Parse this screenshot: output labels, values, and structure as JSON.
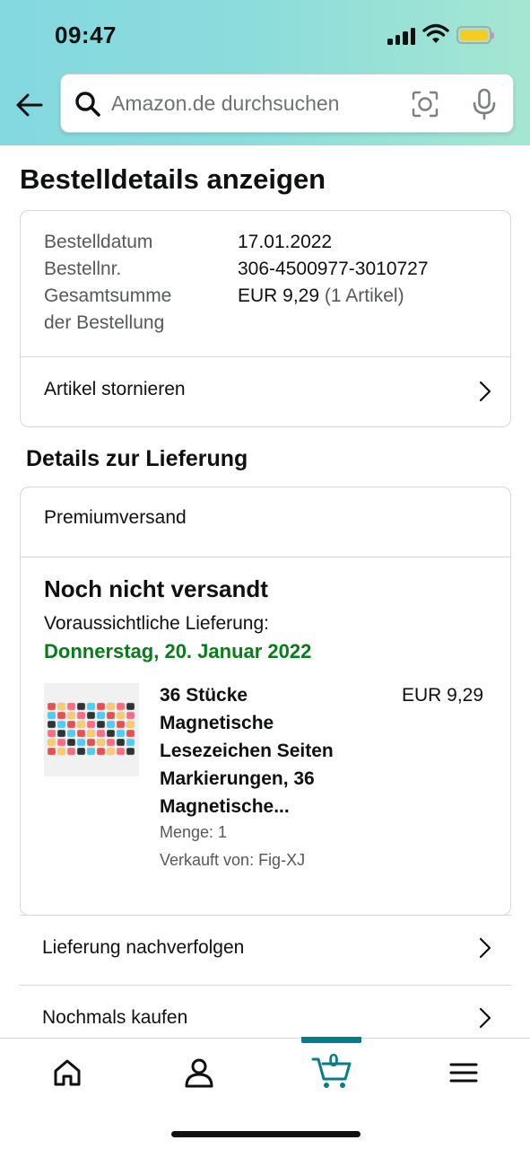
{
  "status_bar": {
    "time": "09:47"
  },
  "search": {
    "placeholder": "Amazon.de durchsuchen"
  },
  "page_title": "Bestelldetails anzeigen",
  "order": {
    "date_label": "Bestelldatum",
    "date_value": "17.01.2022",
    "number_label": "Bestellnr.",
    "number_value": "306-4500977-3010727",
    "total_label_line1": "Gesamtsumme",
    "total_label_line2": "der Bestellung",
    "total_value": "EUR 9,29",
    "total_items": "(1 Artikel)",
    "cancel_link": "Artikel stornieren"
  },
  "delivery_section_title": "Details zur Lieferung",
  "shipment": {
    "shipping_type": "Premiumversand",
    "status": "Noch nicht versandt",
    "delivery_label": "Voraussichtliche Lieferung:",
    "delivery_date": "Donnerstag, 20. Januar 2022",
    "delivery_date_color": "#067d1a",
    "product": {
      "title": "36 Stücke Magnetische Lesezeichen Seiten Markierungen, 36 Magnetische...",
      "price": "EUR 9,29",
      "quantity": "Menge: 1",
      "seller": "Verkauft von: Fig-XJ"
    }
  },
  "actions": {
    "track": "Lieferung nachverfolgen",
    "buy_again": "Nochmals kaufen"
  },
  "bottom_nav": {
    "items": [
      "home-icon",
      "account-icon",
      "cart-icon",
      "menu-icon"
    ],
    "cart_count": "0",
    "active_color": "#067d89"
  }
}
